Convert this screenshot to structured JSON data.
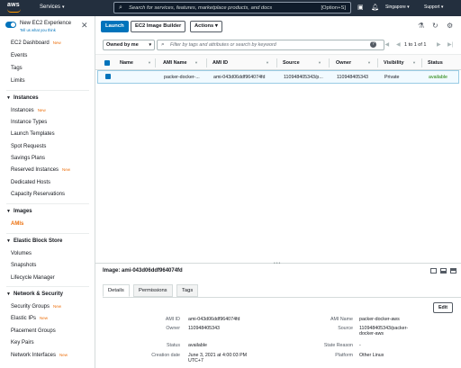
{
  "topnav": {
    "logo_text": "aws",
    "services": "Services",
    "search_placeholder": "Search for services, features, marketplace products, and docs",
    "search_shortcut": "[Option+S]",
    "region": "Singapore",
    "support": "Support"
  },
  "sidebar": {
    "experience_title": "New EC2 Experience",
    "experience_sub": "Tell us what you think",
    "top_items": [
      "EC2 Dashboard",
      "Events",
      "Tags",
      "Limits"
    ],
    "new_badge": "New",
    "sections": [
      {
        "title": "Instances",
        "items": [
          "Instances",
          "Instance Types",
          "Launch Templates",
          "Spot Requests",
          "Savings Plans",
          "Reserved Instances",
          "Dedicated Hosts",
          "Capacity Reservations"
        ]
      },
      {
        "title": "Images",
        "items": [
          "AMIs"
        ]
      },
      {
        "title": "Elastic Block Store",
        "items": [
          "Volumes",
          "Snapshots",
          "Lifecycle Manager"
        ]
      },
      {
        "title": "Network & Security",
        "items": [
          "Security Groups",
          "Elastic IPs",
          "Placement Groups",
          "Key Pairs",
          "Network Interfaces"
        ]
      }
    ]
  },
  "toolbar": {
    "launch": "Launch",
    "image_builder": "EC2 Image Builder",
    "actions": "Actions"
  },
  "filter": {
    "owned": "Owned by me",
    "placeholder": "Filter by tags and attributes or search by keyword",
    "pagination": "1 to 1 of 1"
  },
  "table": {
    "headers": [
      "Name",
      "AMI Name",
      "AMI ID",
      "Source",
      "Owner",
      "Visibility",
      "Status"
    ],
    "row": {
      "name": "",
      "ami_name": "packer-docker-...",
      "ami_id": "ami-043d06ddf964074fd",
      "source": "110948405343/p...",
      "owner": "110948405343",
      "visibility": "Private",
      "status": "available"
    }
  },
  "detail": {
    "title": "Image: ami-043d06ddf964074fd",
    "tabs": [
      "Details",
      "Permissions",
      "Tags"
    ],
    "edit": "Edit",
    "left_labels": [
      "AMI ID",
      "Owner",
      "Status",
      "Creation date"
    ],
    "left_values": [
      "ami-043d06ddf964074fd",
      "110948405343",
      "available",
      "June 3, 2021 at 4:00:03 PM UTC+7"
    ],
    "right_labels": [
      "AMI Name",
      "Source",
      "State Reason",
      "Platform"
    ],
    "right_values": [
      "packer-docker-aws",
      "110948405343/packer-docker-aws",
      "-",
      "Other Linux"
    ]
  },
  "colors": {
    "nav": "#232f3e",
    "accent": "#ec7211",
    "primary": "#0073bb",
    "success": "#1d8102"
  }
}
